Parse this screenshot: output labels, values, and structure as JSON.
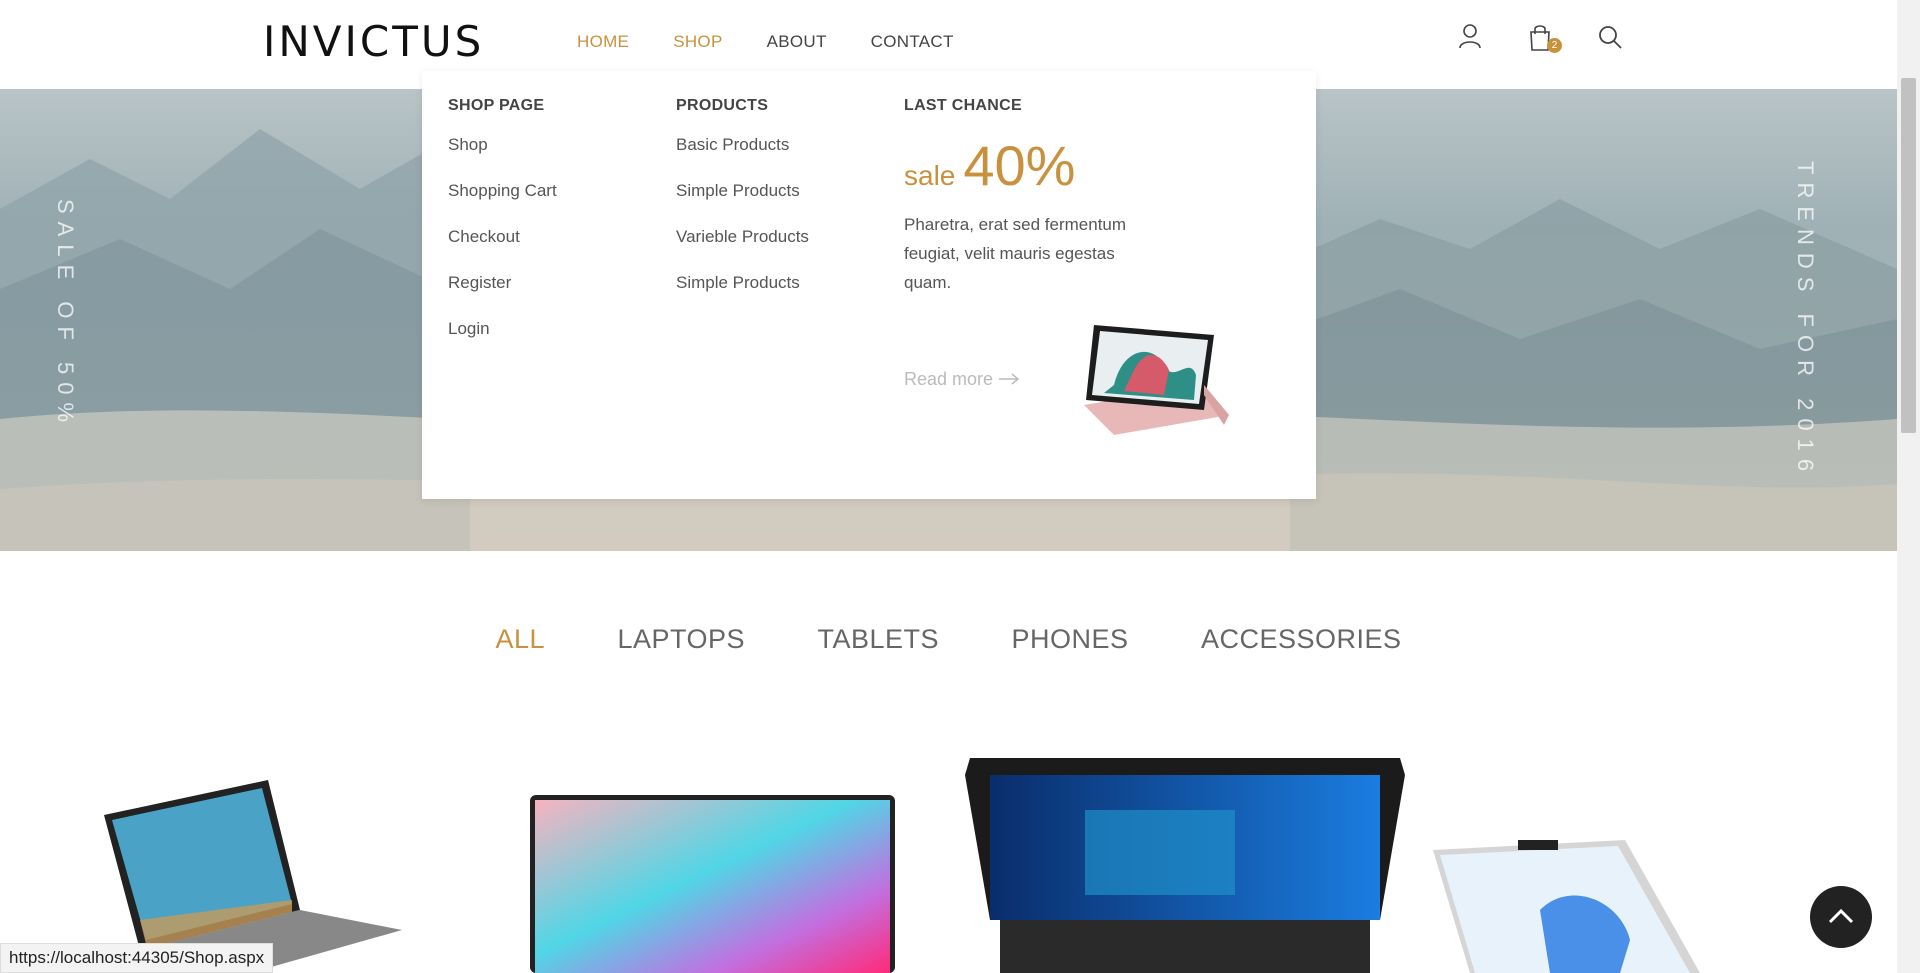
{
  "brand": {
    "logo": "INVICTUS",
    "accent": "#c9913d"
  },
  "nav": {
    "items": [
      {
        "label": "HOME",
        "active": true
      },
      {
        "label": "SHOP",
        "active": true
      },
      {
        "label": "ABOUT",
        "active": false
      },
      {
        "label": "CONTACT",
        "active": false
      }
    ]
  },
  "header_icons": {
    "account": "user-icon",
    "cart": "shopping-bag-icon",
    "cart_count": "2",
    "search": "search-icon"
  },
  "hero": {
    "left_vertical": "SALE OF 50%",
    "right_vertical": "TRENDS FOR 2016"
  },
  "mega_menu": {
    "shop_page": {
      "title": "SHOP PAGE",
      "links": [
        "Shop",
        "Shopping Cart",
        "Checkout",
        "Register",
        "Login"
      ]
    },
    "products": {
      "title": "PRODUCTS",
      "links": [
        "Basic Products",
        "Simple Products",
        "Varieble Products",
        "Simple Products"
      ]
    },
    "last_chance": {
      "title": "LAST CHANCE",
      "sale_word": "sale",
      "sale_percent": "40%",
      "description": "Pharetra, erat sed fermentum feugiat, velit mauris egestas quam.",
      "read_more": "Read more"
    }
  },
  "filters": {
    "tabs": [
      "ALL",
      "LAPTOPS",
      "TABLETS",
      "PHONES",
      "ACCESSORIES"
    ],
    "active": "ALL"
  },
  "status_url": "https://localhost:44305/Shop.aspx"
}
